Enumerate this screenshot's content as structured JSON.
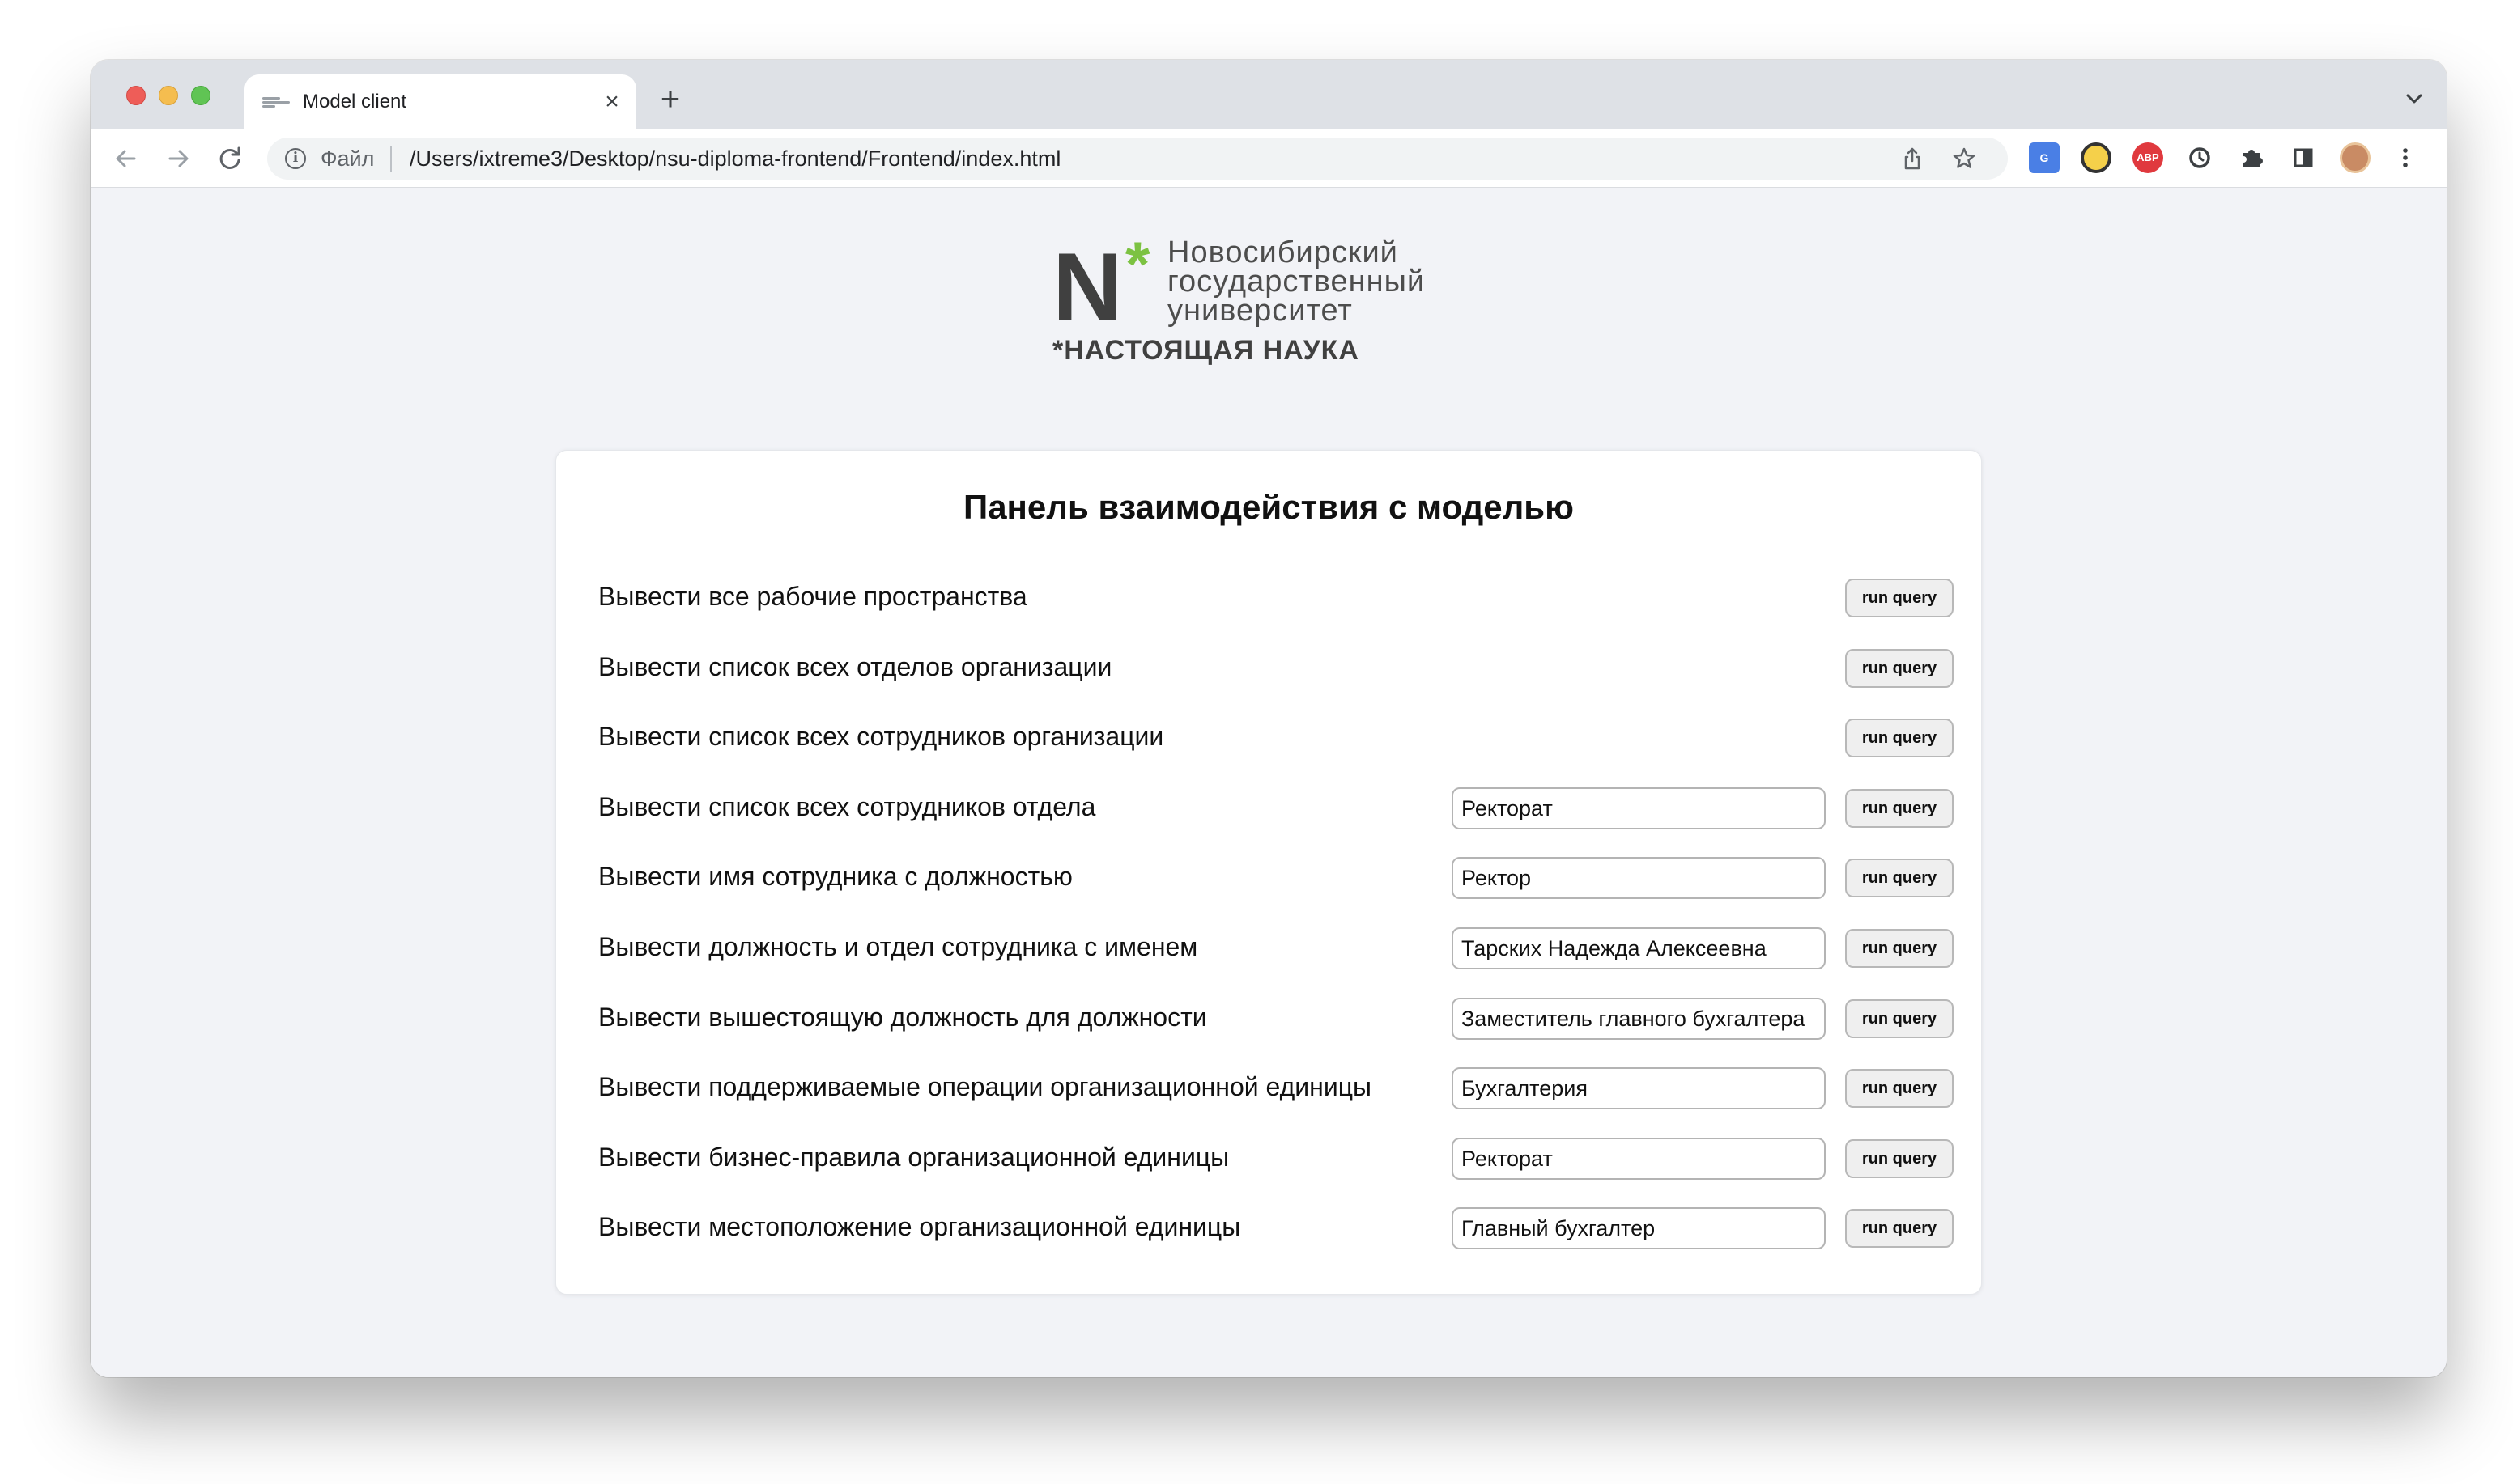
{
  "browser": {
    "tab_title": "Model client",
    "tab_close": "×",
    "new_tab": "+",
    "scheme_label": "Файл",
    "url": "/Users/ixtreme3/Desktop/nsu-diploma-frontend/Frontend/index.html",
    "ext_abp_label": "ABP"
  },
  "logo": {
    "letter": "N",
    "star": "*",
    "line1": "Новосибирский",
    "line2": "государственный",
    "line3": "университет",
    "tagline": "*НАСТОЯЩАЯ НАУКА"
  },
  "panel": {
    "title": "Панель взаимодействия с моделью",
    "button_label": "run query",
    "queries": [
      {
        "label": "Вывести все рабочие пространства"
      },
      {
        "label": "Вывести список всех отделов организации"
      },
      {
        "label": "Вывести список всех сотрудников организации"
      },
      {
        "label": "Вывести список всех сотрудников отдела",
        "value": "Ректорат"
      },
      {
        "label": "Вывести имя сотрудника с должностью",
        "value": "Ректор"
      },
      {
        "label": "Вывести должность и отдел сотрудника с именем",
        "value": "Тарских Надежда Алексеевна"
      },
      {
        "label": "Вывести вышестоящую должность для должности",
        "value": "Заместитель главного бухгалтера"
      },
      {
        "label": "Вывести поддерживаемые операции организационной единицы",
        "value": "Бухгалтерия"
      },
      {
        "label": "Вывести бизнес-правила организационной единицы",
        "value": "Ректорат"
      },
      {
        "label": "Вывести местоположение организационной единицы",
        "value": "Главный бухгалтер"
      }
    ]
  },
  "colors": {
    "nsu_green": "#7cc242",
    "logo_gray": "#404040",
    "page_bg": "#f2f3f7"
  }
}
